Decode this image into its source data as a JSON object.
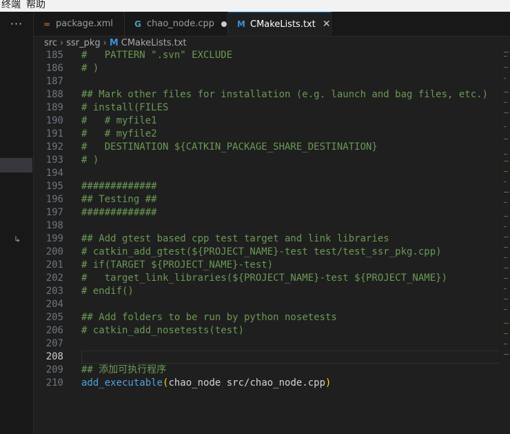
{
  "menubar": {
    "items": [
      "终端",
      "帮助"
    ]
  },
  "tabs": [
    {
      "label": "package.xml",
      "icon": "rss-icon",
      "icon_color": "#e37933",
      "active": false
    },
    {
      "label": "chao_node.cpp",
      "icon": "cpp-icon",
      "icon_color": "#519aba",
      "active": false,
      "modified": true
    },
    {
      "label": "CMakeLists.txt",
      "icon": "cmake-icon",
      "icon_color": "#3b8fd6",
      "active": true,
      "close": "✕"
    }
  ],
  "breadcrumb": {
    "items": [
      "src",
      "ssr_pkg",
      "CMakeLists.txt"
    ],
    "file_icon": "M"
  },
  "editor": {
    "current_line": "208",
    "lines": [
      {
        "n": "185",
        "t": "#   PATTERN \".svn\" EXCLUDE"
      },
      {
        "n": "186",
        "t": "# )"
      },
      {
        "n": "187",
        "t": ""
      },
      {
        "n": "188",
        "t": "## Mark other files for installation (e.g. launch and bag files, etc.)"
      },
      {
        "n": "189",
        "t": "# install(FILES"
      },
      {
        "n": "190",
        "t": "#   # myfile1"
      },
      {
        "n": "191",
        "t": "#   # myfile2"
      },
      {
        "n": "192",
        "t": "#   DESTINATION ${CATKIN_PACKAGE_SHARE_DESTINATION}"
      },
      {
        "n": "193",
        "t": "# )"
      },
      {
        "n": "194",
        "t": ""
      },
      {
        "n": "195",
        "t": "#############"
      },
      {
        "n": "196",
        "t": "## Testing ##"
      },
      {
        "n": "197",
        "t": "#############"
      },
      {
        "n": "198",
        "t": ""
      },
      {
        "n": "199",
        "t": "## Add gtest based cpp test target and link libraries"
      },
      {
        "n": "200",
        "t": "# catkin_add_gtest(${PROJECT_NAME}-test test/test_ssr_pkg.cpp)"
      },
      {
        "n": "201",
        "t": "# if(TARGET ${PROJECT_NAME}-test)"
      },
      {
        "n": "202",
        "t": "#   target_link_libraries(${PROJECT_NAME}-test ${PROJECT_NAME})"
      },
      {
        "n": "203",
        "t": "# endif()"
      },
      {
        "n": "204",
        "t": ""
      },
      {
        "n": "205",
        "t": "## Add folders to be run by python nosetests"
      },
      {
        "n": "206",
        "t": "# catkin_add_nosetests(test)"
      },
      {
        "n": "207",
        "t": ""
      },
      {
        "n": "208",
        "t": ""
      },
      {
        "n": "209",
        "t": "## 添加可执行程序"
      },
      {
        "n": "210",
        "t": "",
        "fn": "add_executable",
        "open": "(",
        "args": "chao_node src/chao_node.cpp",
        "close": ")"
      }
    ]
  },
  "activity": {
    "more_icon": "···",
    "wrap_icon": "↳"
  }
}
